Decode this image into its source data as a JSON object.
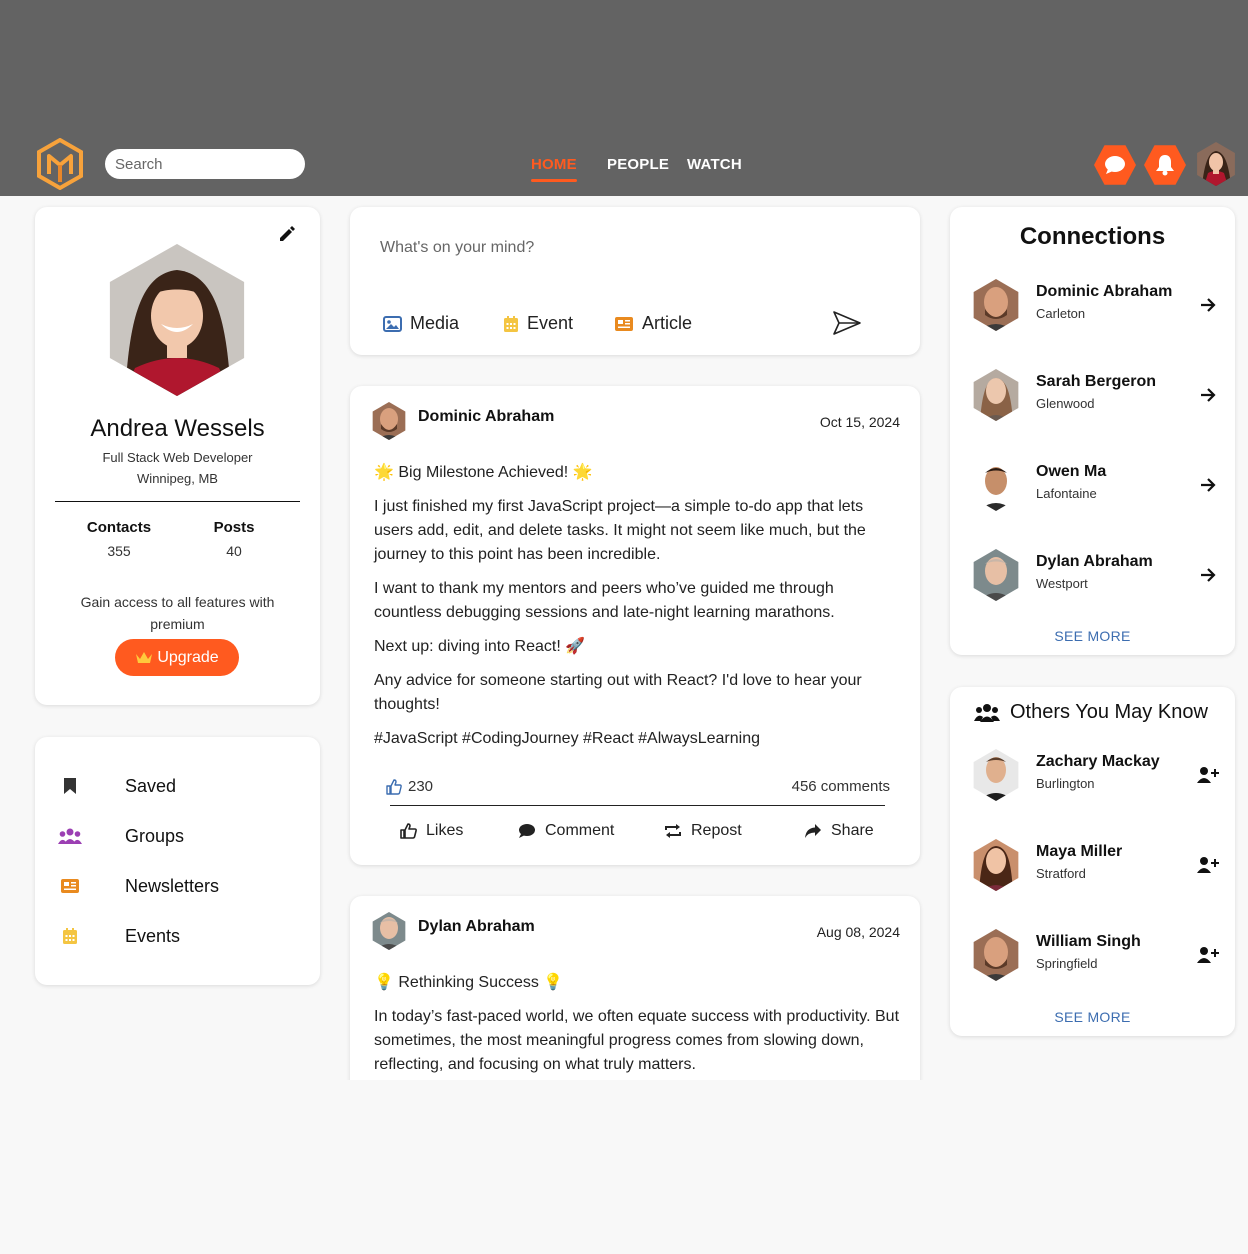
{
  "header": {
    "search_placeholder": "Search",
    "nav": [
      "HOME",
      "PEOPLE",
      "WATCH"
    ],
    "active_nav": "HOME",
    "accent_color": "#ff5a1f"
  },
  "profile": {
    "name": "Andrea Wessels",
    "title": "Full Stack Web Developer",
    "location": "Winnipeg, MB",
    "stats": [
      {
        "label": "Contacts",
        "value": "355"
      },
      {
        "label": "Posts",
        "value": "40"
      }
    ],
    "premium_text": "Gain access to all features with premium",
    "upgrade_label": "Upgrade"
  },
  "menu": [
    {
      "label": "Saved",
      "icon": "bookmark-icon"
    },
    {
      "label": "Groups",
      "icon": "groups-icon"
    },
    {
      "label": "Newsletters",
      "icon": "newspaper-icon"
    },
    {
      "label": "Events",
      "icon": "calendar-icon"
    }
  ],
  "composer": {
    "placeholder": "What's on your mind?",
    "actions": [
      {
        "label": "Media",
        "icon": "image-icon"
      },
      {
        "label": "Event",
        "icon": "calendar-icon"
      },
      {
        "label": "Article",
        "icon": "newspaper-icon"
      }
    ]
  },
  "posts": [
    {
      "author": "Dominic Abraham",
      "date": "Oct 15, 2024",
      "headline": "🌟 Big Milestone Achieved! 🌟",
      "paragraphs": [
        "I just finished my first JavaScript project—a simple to-do app that lets users add, edit, and delete tasks. It might not seem like much, but the journey to this point has been incredible.",
        "I want to thank my mentors and peers who’ve guided me through countless debugging sessions and late-night learning marathons.",
        "Next up: diving into React! 🚀",
        "Any advice for someone starting out with React? I'd love to hear your thoughts!",
        "#JavaScript #CodingJourney #React #AlwaysLearning"
      ],
      "likes": "230",
      "comments": "456 comments",
      "actions": [
        "Likes",
        "Comment",
        "Repost",
        "Share"
      ]
    },
    {
      "author": "Dylan Abraham",
      "date": "Aug 08, 2024",
      "headline": "💡 Rethinking Success 💡",
      "paragraphs": [
        "In today’s fast-paced world, we often equate success with productivity. But sometimes, the most meaningful progress comes from slowing down, reflecting, and focusing on what truly matters."
      ]
    }
  ],
  "connections": {
    "title": "Connections",
    "people": [
      {
        "name": "Dominic Abraham",
        "location": "Carleton"
      },
      {
        "name": "Sarah Bergeron",
        "location": "Glenwood"
      },
      {
        "name": "Owen Ma",
        "location": "Lafontaine"
      },
      {
        "name": "Dylan Abraham",
        "location": "Westport"
      }
    ],
    "see_more": "SEE MORE"
  },
  "others": {
    "title": "Others You May Know",
    "people": [
      {
        "name": "Zachary Mackay",
        "location": "Burlington"
      },
      {
        "name": "Maya Miller",
        "location": "Stratford"
      },
      {
        "name": "William Singh",
        "location": "Springfield"
      }
    ],
    "see_more": "SEE MORE"
  }
}
